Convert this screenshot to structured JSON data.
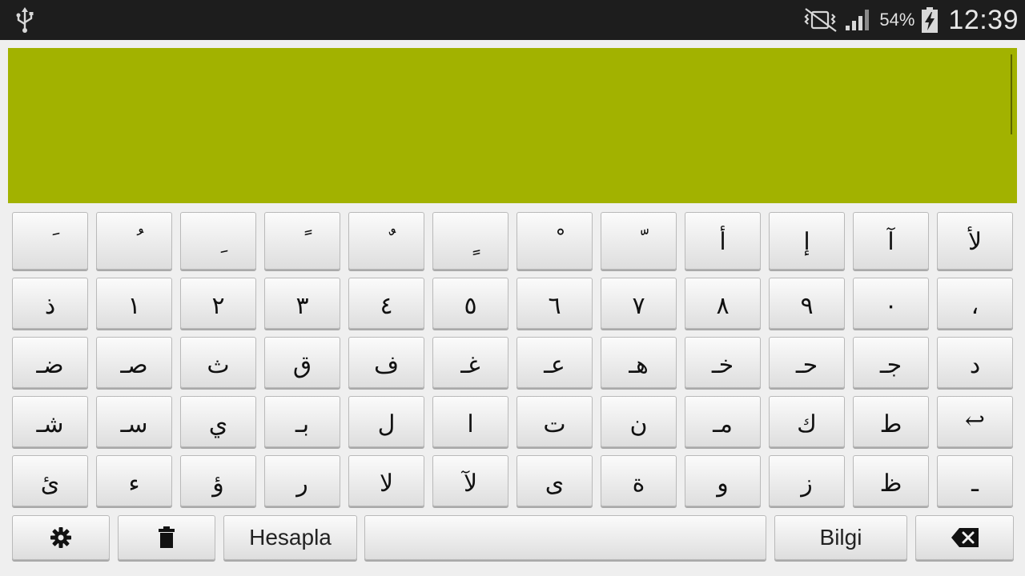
{
  "status_bar": {
    "usb_icon": "usb-icon",
    "mute_icon": "vibrate-mute-icon",
    "signal_icon": "signal-icon",
    "battery_percent": "54%",
    "battery_icon": "battery-charging-icon",
    "time": "12:39"
  },
  "display": {
    "text": "",
    "background": "#a2b200"
  },
  "keyboard": {
    "row1": [
      "َ",
      "ُ",
      "ِ",
      "ً",
      "ٌ",
      "ٍ",
      "ْ",
      "ّ",
      "أ",
      "إ",
      "آ",
      "لأ"
    ],
    "row2": [
      "ذ",
      "١",
      "٢",
      "٣",
      "٤",
      "٥",
      "٦",
      "٧",
      "٨",
      "٩",
      "٠",
      "،"
    ],
    "row3": [
      "ضـ",
      "صـ",
      "ث",
      "ق",
      "ف",
      "غـ",
      "عـ",
      "هـ",
      "خـ",
      "حـ",
      "جـ",
      "د"
    ],
    "row4": [
      "شـ",
      "سـ",
      "ي",
      "بـ",
      "ل",
      "ا",
      "ت",
      "ن",
      "مـ",
      "ك",
      "ط",
      "↩"
    ],
    "row5": [
      "ئ",
      "ء",
      "ؤ",
      "ر",
      "لا",
      "لآ",
      "ى",
      "ة",
      "و",
      "ز",
      "ظ",
      "ـ"
    ],
    "bottom": {
      "settings_icon": "gear-icon",
      "clear_icon": "trash-icon",
      "calculate_label": "Hesapla",
      "space_label": "",
      "info_label": "Bilgi",
      "backspace_icon": "backspace-icon"
    }
  }
}
